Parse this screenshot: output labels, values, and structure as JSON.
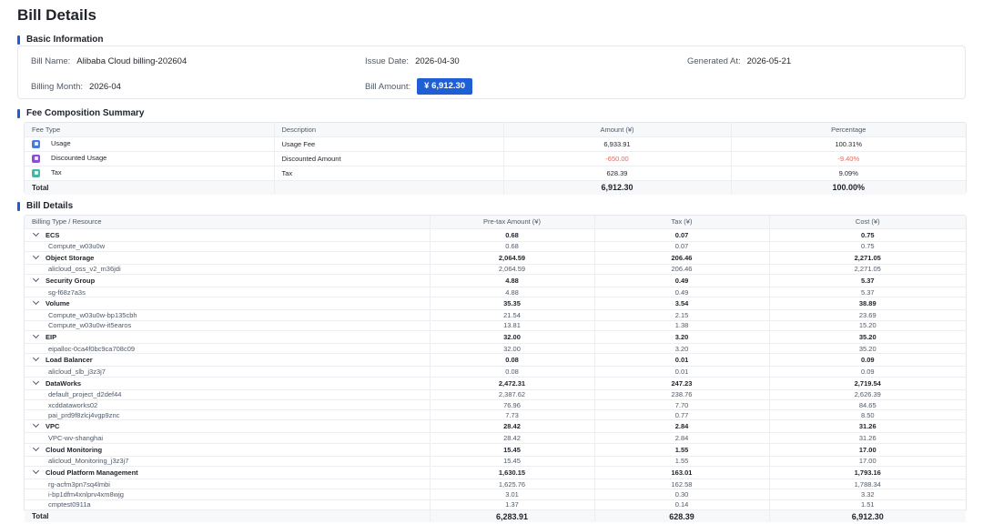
{
  "page": {
    "title": "Bill Details"
  },
  "basic_info": {
    "section_title": "Basic Information",
    "bill_name_label": "Bill Name:",
    "bill_name": "Alibaba Cloud billing-202604",
    "issue_date_label": "Issue Date:",
    "issue_date": "2026-04-30",
    "generated_at_label": "Generated At:",
    "generated_at": "2026-05-21",
    "billing_month_label": "Billing Month:",
    "billing_month": "2026-04",
    "bill_amount_label": "Bill Amount:",
    "bill_amount": "¥ 6,912.30"
  },
  "fee_summary": {
    "section_title": "Fee Composition Summary",
    "headers": [
      "Fee Type",
      "Description",
      "Amount (¥)",
      "Percentage"
    ],
    "rows": [
      {
        "type": "Usage",
        "description": "Usage Fee",
        "amount": "6,933.91",
        "percentage": "100.31%",
        "color": "#4a7bd8",
        "negative": false
      },
      {
        "type": "Discounted Usage",
        "description": "Discounted Amount",
        "amount": "-650.00",
        "percentage": "-9.40%",
        "color": "#8a4fd3",
        "negative": true
      },
      {
        "type": "Tax",
        "description": "Tax",
        "amount": "628.39",
        "percentage": "9.09%",
        "color": "#49b6a4",
        "negative": false
      }
    ],
    "total": {
      "label": "Total",
      "amount": "6,912.30",
      "percentage": "100.00%"
    }
  },
  "bill_details": {
    "section_title": "Bill Details",
    "headers": [
      "Billing Type / Resource",
      "Pre-tax Amount (¥)",
      "Tax (¥)",
      "Cost (¥)"
    ],
    "groups": [
      {
        "name": "ECS",
        "pretax": "0.68",
        "tax": "0.07",
        "cost": "0.75",
        "items": [
          {
            "name": "Compute_w03u0w",
            "pretax": "0.68",
            "tax": "0.07",
            "cost": "0.75"
          }
        ]
      },
      {
        "name": "Object Storage",
        "pretax": "2,064.59",
        "tax": "206.46",
        "cost": "2,271.05",
        "items": [
          {
            "name": "alicloud_oss_v2_m36jdi",
            "pretax": "2,064.59",
            "tax": "206.46",
            "cost": "2,271.05"
          }
        ]
      },
      {
        "name": "Security Group",
        "pretax": "4.88",
        "tax": "0.49",
        "cost": "5.37",
        "items": [
          {
            "name": "sg-f68z7a3s",
            "pretax": "4.88",
            "tax": "0.49",
            "cost": "5.37"
          }
        ]
      },
      {
        "name": "Volume",
        "pretax": "35.35",
        "tax": "3.54",
        "cost": "38.89",
        "items": [
          {
            "name": "Compute_w03u0w-bp135cbh",
            "pretax": "21.54",
            "tax": "2.15",
            "cost": "23.69"
          },
          {
            "name": "Compute_w03u0w-it5earos",
            "pretax": "13.81",
            "tax": "1.38",
            "cost": "15.20"
          }
        ]
      },
      {
        "name": "EIP",
        "pretax": "32.00",
        "tax": "3.20",
        "cost": "35.20",
        "items": [
          {
            "name": "eipalloc-0ca4f0bc9ca708c09",
            "pretax": "32.00",
            "tax": "3.20",
            "cost": "35.20"
          }
        ]
      },
      {
        "name": "Load Balancer",
        "pretax": "0.08",
        "tax": "0.01",
        "cost": "0.09",
        "items": [
          {
            "name": "alicloud_slb_j3z3j7",
            "pretax": "0.08",
            "tax": "0.01",
            "cost": "0.09"
          }
        ]
      },
      {
        "name": "DataWorks",
        "pretax": "2,472.31",
        "tax": "247.23",
        "cost": "2,719.54",
        "items": [
          {
            "name": "default_project_d2def44",
            "pretax": "2,387.62",
            "tax": "238.76",
            "cost": "2,626.39"
          },
          {
            "name": "xcddataworks02",
            "pretax": "76.96",
            "tax": "7.70",
            "cost": "84.65"
          },
          {
            "name": "pai_prd9f8zlcj4vgp9znc",
            "pretax": "7.73",
            "tax": "0.77",
            "cost": "8.50"
          }
        ]
      },
      {
        "name": "VPC",
        "pretax": "28.42",
        "tax": "2.84",
        "cost": "31.26",
        "items": [
          {
            "name": "VPC-wv-shanghai",
            "pretax": "28.42",
            "tax": "2.84",
            "cost": "31.26"
          }
        ]
      },
      {
        "name": "Cloud Monitoring",
        "pretax": "15.45",
        "tax": "1.55",
        "cost": "17.00",
        "items": [
          {
            "name": "alicloud_Monitoring_j3z3j7",
            "pretax": "15.45",
            "tax": "1.55",
            "cost": "17.00"
          }
        ]
      },
      {
        "name": "Cloud Platform Management",
        "pretax": "1,630.15",
        "tax": "163.01",
        "cost": "1,793.16",
        "items": [
          {
            "name": "rg-acfm3pn7sq4lmbi",
            "pretax": "1,625.76",
            "tax": "162.58",
            "cost": "1,788.34"
          },
          {
            "name": "i-bp1dfm4xnlprv4xm8wjg",
            "pretax": "3.01",
            "tax": "0.30",
            "cost": "3.32"
          },
          {
            "name": "cmptest0911a",
            "pretax": "1.37",
            "tax": "0.14",
            "cost": "1.51"
          }
        ]
      }
    ],
    "total": {
      "label": "Total",
      "pretax": "6,283.91",
      "tax": "628.39",
      "cost": "6,912.30"
    }
  }
}
